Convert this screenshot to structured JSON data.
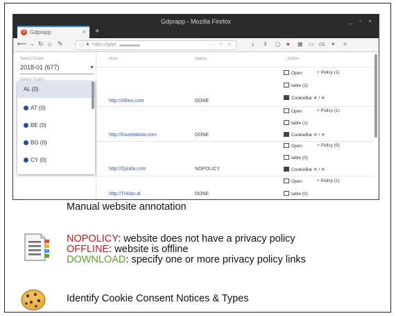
{
  "browser": {
    "window_title": "Gdprapp - Mozilla Firefox",
    "tab_label": "Gdprapp",
    "url_prefix": "https://gdpr",
    "window_controls": "_ ▫ ×"
  },
  "sidebar": {
    "select_crawl_label": "Select Crawl",
    "select_crawl_value": "2018-01 (677)",
    "select_toplist_label": "Select Toplist",
    "dropdown_items": [
      {
        "label": "AL (0)",
        "selected": true
      },
      {
        "label": "AT (0)",
        "selected": false
      },
      {
        "label": "BE (0)",
        "selected": false
      },
      {
        "label": "BG (0)",
        "selected": false
      },
      {
        "label": "CY (0)",
        "selected": false
      }
    ]
  },
  "table": {
    "headers": {
      "host": "Host",
      "status": "Status",
      "action": "Action"
    },
    "rows": [
      {
        "host": "http://Albeu.com",
        "status": "DONE",
        "policy": "Policy (1)",
        "table": "table (2)"
      },
      {
        "host": "http://Gazetabota.com",
        "status": "DONE",
        "policy": "Policy (1)",
        "table": "table (1)"
      },
      {
        "host": "http://Gjirafa.com",
        "status": "NOPOLICY",
        "policy": "Policy (0)",
        "table": "table (0)"
      },
      {
        "host": "http://Tvklan.al",
        "status": "DONE",
        "policy": "Policy (1)",
        "table": "table (0)"
      }
    ],
    "open_label": "Open",
    "cookiebar_label": "CookieBar",
    "cookiebar_actions": "✕ / ✕"
  },
  "annotations": {
    "caption": "Manual website annotation",
    "statuses": [
      {
        "keyword": "NOPOLICY",
        "text": ": website does not have a privacy policy",
        "color": "#d11919"
      },
      {
        "keyword": "OFFLINE",
        "text": ": website is offline",
        "color": "#d11919"
      },
      {
        "keyword": "DOWNLOAD",
        "text": ": specify one or more privacy policy links",
        "color": "#5ba32b"
      }
    ],
    "cookie_caption": "Identify Cookie Consent Notices & Types"
  },
  "icons": [
    "firefox-tab-icon",
    "back-icon",
    "forward-icon",
    "reload-icon",
    "home-icon",
    "settings-icon",
    "document-list-icon",
    "cookie-icon"
  ]
}
